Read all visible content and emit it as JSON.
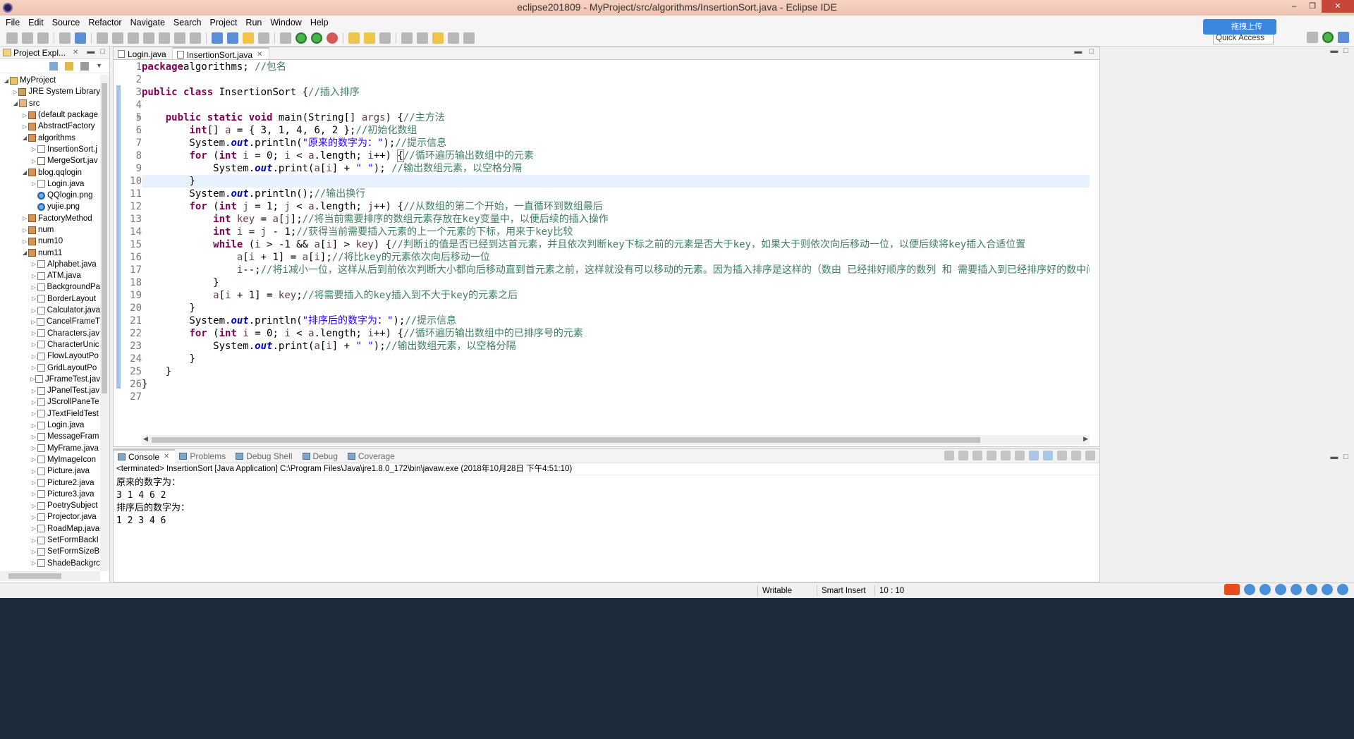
{
  "window": {
    "title": "eclipse201809 - MyProject/src/algorithms/InsertionSort.java - Eclipse IDE"
  },
  "menu": [
    "File",
    "Edit",
    "Source",
    "Refactor",
    "Navigate",
    "Search",
    "Project",
    "Run",
    "Window",
    "Help"
  ],
  "toolbar": {
    "quick_access": "Quick Access",
    "upload_label": "拖拽上传"
  },
  "project_explorer": {
    "title": "Project Expl...",
    "items": [
      {
        "label": "MyProject",
        "depth": 0,
        "icon": "project",
        "arrow": "▼"
      },
      {
        "label": "JRE System Library",
        "depth": 1,
        "icon": "lib",
        "arrow": "▶"
      },
      {
        "label": "src",
        "depth": 1,
        "icon": "src",
        "arrow": "▼"
      },
      {
        "label": "(default package",
        "depth": 2,
        "icon": "pkg",
        "arrow": "▶"
      },
      {
        "label": "AbstractFactory",
        "depth": 2,
        "icon": "pkg",
        "arrow": "▶"
      },
      {
        "label": "algorithms",
        "depth": 2,
        "icon": "pkg",
        "arrow": "▼"
      },
      {
        "label": "InsertionSort.j",
        "depth": 3,
        "icon": "java",
        "arrow": "▶"
      },
      {
        "label": "MergeSort.jav",
        "depth": 3,
        "icon": "javaerr",
        "arrow": "▶"
      },
      {
        "label": "blog.qqlogin",
        "depth": 2,
        "icon": "pkg",
        "arrow": "▼"
      },
      {
        "label": "Login.java",
        "depth": 3,
        "icon": "java",
        "arrow": "▶"
      },
      {
        "label": "QQlogin.png",
        "depth": 3,
        "icon": "png",
        "arrow": ""
      },
      {
        "label": "yujie.png",
        "depth": 3,
        "icon": "png",
        "arrow": ""
      },
      {
        "label": "FactoryMethod",
        "depth": 2,
        "icon": "pkg",
        "arrow": "▶"
      },
      {
        "label": "num",
        "depth": 2,
        "icon": "pkg",
        "arrow": "▶"
      },
      {
        "label": "num10",
        "depth": 2,
        "icon": "pkg",
        "arrow": "▶"
      },
      {
        "label": "num11",
        "depth": 2,
        "icon": "pkg",
        "arrow": "▼"
      },
      {
        "label": "Alphabet.java",
        "depth": 3,
        "icon": "java",
        "arrow": "▶"
      },
      {
        "label": "ATM.java",
        "depth": 3,
        "icon": "java",
        "arrow": "▶"
      },
      {
        "label": "BackgroundPa",
        "depth": 3,
        "icon": "java",
        "arrow": "▶"
      },
      {
        "label": "BorderLayout",
        "depth": 3,
        "icon": "java",
        "arrow": "▶"
      },
      {
        "label": "Calculator.java",
        "depth": 3,
        "icon": "java",
        "arrow": "▶"
      },
      {
        "label": "CancelFrameT",
        "depth": 3,
        "icon": "java",
        "arrow": "▶"
      },
      {
        "label": "Characters.jav",
        "depth": 3,
        "icon": "java",
        "arrow": "▶"
      },
      {
        "label": "CharacterUnic",
        "depth": 3,
        "icon": "java",
        "arrow": "▶"
      },
      {
        "label": "FlowLayoutPo",
        "depth": 3,
        "icon": "java",
        "arrow": "▶"
      },
      {
        "label": "GridLayoutPo",
        "depth": 3,
        "icon": "java",
        "arrow": "▶"
      },
      {
        "label": "JFrameTest.jav",
        "depth": 3,
        "icon": "java",
        "arrow": "▶"
      },
      {
        "label": "JPanelTest.jav",
        "depth": 3,
        "icon": "java",
        "arrow": "▶"
      },
      {
        "label": "JScrollPaneTe",
        "depth": 3,
        "icon": "java",
        "arrow": "▶"
      },
      {
        "label": "JTextFieldTest",
        "depth": 3,
        "icon": "java",
        "arrow": "▶"
      },
      {
        "label": "Login.java",
        "depth": 3,
        "icon": "java",
        "arrow": "▶"
      },
      {
        "label": "MessageFram",
        "depth": 3,
        "icon": "java",
        "arrow": "▶"
      },
      {
        "label": "MyFrame.java",
        "depth": 3,
        "icon": "java",
        "arrow": "▶"
      },
      {
        "label": "MyImageIcon",
        "depth": 3,
        "icon": "java",
        "arrow": "▶"
      },
      {
        "label": "Picture.java",
        "depth": 3,
        "icon": "java",
        "arrow": "▶"
      },
      {
        "label": "Picture2.java",
        "depth": 3,
        "icon": "java",
        "arrow": "▶"
      },
      {
        "label": "Picture3.java",
        "depth": 3,
        "icon": "java",
        "arrow": "▶"
      },
      {
        "label": "PoetrySubject",
        "depth": 3,
        "icon": "java",
        "arrow": "▶"
      },
      {
        "label": "Projector.java",
        "depth": 3,
        "icon": "java",
        "arrow": "▶"
      },
      {
        "label": "RoadMap.java",
        "depth": 3,
        "icon": "java",
        "arrow": "▶"
      },
      {
        "label": "SetFormBackI",
        "depth": 3,
        "icon": "java",
        "arrow": "▶"
      },
      {
        "label": "SetFormSizeB",
        "depth": 3,
        "icon": "java",
        "arrow": "▶"
      },
      {
        "label": "ShadeBackgrc",
        "depth": 3,
        "icon": "java",
        "arrow": "▶"
      }
    ]
  },
  "editor": {
    "tabs": [
      {
        "label": "Login.java",
        "active": false
      },
      {
        "label": "InsertionSort.java",
        "active": true
      }
    ],
    "current_line": 10,
    "lines": [
      [
        [
          "kw",
          "package"
        ],
        [
          "",
          "algorithms; "
        ],
        [
          "cm",
          "//包名"
        ]
      ],
      [],
      [
        [
          "kw",
          "public class"
        ],
        [
          "",
          " InsertionSort {"
        ],
        [
          "cm",
          "//插入排序"
        ]
      ],
      [],
      [
        [
          "",
          "    "
        ],
        [
          "kw",
          "public static void"
        ],
        [
          "",
          " main(String[] "
        ],
        [
          "vr",
          "args"
        ],
        [
          "",
          ") {"
        ],
        [
          "cm",
          "//主方法"
        ]
      ],
      [
        [
          "",
          "        "
        ],
        [
          "kw",
          "int"
        ],
        [
          "",
          "[] "
        ],
        [
          "vr",
          "a"
        ],
        [
          "",
          " = { 3, 1, 4, 6, 2 };"
        ],
        [
          "cm",
          "//初始化数组"
        ]
      ],
      [
        [
          "",
          "        System."
        ],
        [
          "fld",
          "out"
        ],
        [
          "",
          ".println("
        ],
        [
          "st",
          "\"原来的数字为：\""
        ],
        [
          "",
          ");"
        ],
        [
          "cm",
          "//提示信息"
        ]
      ],
      [
        [
          "",
          "        "
        ],
        [
          "kw",
          "for"
        ],
        [
          "",
          " ("
        ],
        [
          "kw",
          "int"
        ],
        [
          "",
          " "
        ],
        [
          "vr",
          "i"
        ],
        [
          "",
          " = 0; "
        ],
        [
          "vr",
          "i"
        ],
        [
          "",
          " < "
        ],
        [
          "vr",
          "a"
        ],
        [
          "",
          ".length; "
        ],
        [
          "vr",
          "i"
        ],
        [
          "",
          "++) "
        ],
        [
          "box",
          "{"
        ],
        [
          "cm",
          "//循环遍历输出数组中的元素"
        ]
      ],
      [
        [
          "",
          "            System."
        ],
        [
          "fld",
          "out"
        ],
        [
          "",
          ".print("
        ],
        [
          "vr",
          "a"
        ],
        [
          "",
          "["
        ],
        [
          "vr",
          "i"
        ],
        [
          "",
          "] + "
        ],
        [
          "st",
          "\" \""
        ],
        [
          "",
          "); "
        ],
        [
          "cm",
          "//输出数组元素，以空格分隔"
        ]
      ],
      [
        [
          "",
          "        }"
        ]
      ],
      [
        [
          "",
          "        System."
        ],
        [
          "fld",
          "out"
        ],
        [
          "",
          ".println();"
        ],
        [
          "cm",
          "//输出换行"
        ]
      ],
      [
        [
          "",
          "        "
        ],
        [
          "kw",
          "for"
        ],
        [
          "",
          " ("
        ],
        [
          "kw",
          "int"
        ],
        [
          "",
          " "
        ],
        [
          "vr",
          "j"
        ],
        [
          "",
          " = 1; "
        ],
        [
          "vr",
          "j"
        ],
        [
          "",
          " < "
        ],
        [
          "vr",
          "a"
        ],
        [
          "",
          ".length; "
        ],
        [
          "vr",
          "j"
        ],
        [
          "",
          "++) {"
        ],
        [
          "cm",
          "//从数组的第二个开始，一直循环到数组最后"
        ]
      ],
      [
        [
          "",
          "            "
        ],
        [
          "kw",
          "int"
        ],
        [
          "",
          " "
        ],
        [
          "vr",
          "key"
        ],
        [
          "",
          " = "
        ],
        [
          "vr",
          "a"
        ],
        [
          "",
          "["
        ],
        [
          "vr",
          "j"
        ],
        [
          "",
          "];"
        ],
        [
          "cm",
          "//将当前需要排序的数组元素存放在key变量中，以便后续的插入操作"
        ]
      ],
      [
        [
          "",
          "            "
        ],
        [
          "kw",
          "int"
        ],
        [
          "",
          " "
        ],
        [
          "vr",
          "i"
        ],
        [
          "",
          " = "
        ],
        [
          "vr",
          "j"
        ],
        [
          "",
          " - 1;"
        ],
        [
          "cm",
          "//获得当前需要插入元素的上一个元素的下标，用来于key比较"
        ]
      ],
      [
        [
          "",
          "            "
        ],
        [
          "kw",
          "while"
        ],
        [
          "",
          " ("
        ],
        [
          "vr",
          "i"
        ],
        [
          "",
          " > -1 && "
        ],
        [
          "vr",
          "a"
        ],
        [
          "",
          "["
        ],
        [
          "vr",
          "i"
        ],
        [
          "",
          "] > "
        ],
        [
          "vr",
          "key"
        ],
        [
          "",
          ") {"
        ],
        [
          "cm",
          "//判断i的值是否已经到达首元素，并且依次判断key下标之前的元素是否大于key，如果大于则依次向后移动一位，以便后续将key插入合适位置"
        ]
      ],
      [
        [
          "",
          "                "
        ],
        [
          "vr",
          "a"
        ],
        [
          "",
          "["
        ],
        [
          "vr",
          "i"
        ],
        [
          "",
          " + 1] = "
        ],
        [
          "vr",
          "a"
        ],
        [
          "",
          "["
        ],
        [
          "vr",
          "i"
        ],
        [
          "",
          "];"
        ],
        [
          "cm",
          "//将比key的元素依次向后移动一位"
        ]
      ],
      [
        [
          "",
          "                "
        ],
        [
          "vr",
          "i"
        ],
        [
          "",
          "--;"
        ],
        [
          "cm",
          "//将i减小一位，这样从后到前依次判断大小都向后移动直到首元素之前，这样就没有可以移动的元素。因为插入排序是这样的（数由 已经排好顺序的数列 和 需要插入到已经排序好的数中间的数 和 等待与已经排序好"
        ]
      ],
      [
        [
          "",
          "            }"
        ]
      ],
      [
        [
          "",
          "            "
        ],
        [
          "vr",
          "a"
        ],
        [
          "",
          "["
        ],
        [
          "vr",
          "i"
        ],
        [
          "",
          " + 1] = "
        ],
        [
          "vr",
          "key"
        ],
        [
          "",
          ";"
        ],
        [
          "cm",
          "//将需要插入的key插入到不大于key的元素之后"
        ]
      ],
      [
        [
          "",
          "        }"
        ]
      ],
      [
        [
          "",
          "        System."
        ],
        [
          "fld",
          "out"
        ],
        [
          "",
          ".println("
        ],
        [
          "st",
          "\"排序后的数字为：\""
        ],
        [
          "",
          ");"
        ],
        [
          "cm",
          "//提示信息"
        ]
      ],
      [
        [
          "",
          "        "
        ],
        [
          "kw",
          "for"
        ],
        [
          "",
          " ("
        ],
        [
          "kw",
          "int"
        ],
        [
          "",
          " "
        ],
        [
          "vr",
          "i"
        ],
        [
          "",
          " = 0; "
        ],
        [
          "vr",
          "i"
        ],
        [
          "",
          " < "
        ],
        [
          "vr",
          "a"
        ],
        [
          "",
          ".length; "
        ],
        [
          "vr",
          "i"
        ],
        [
          "",
          "++) {"
        ],
        [
          "cm",
          "//循环遍历输出数组中的已排序号的元素"
        ]
      ],
      [
        [
          "",
          "            System."
        ],
        [
          "fld",
          "out"
        ],
        [
          "",
          ".print("
        ],
        [
          "vr",
          "a"
        ],
        [
          "",
          "["
        ],
        [
          "vr",
          "i"
        ],
        [
          "",
          "] + "
        ],
        [
          "st",
          "\" \""
        ],
        [
          "",
          ");"
        ],
        [
          "cm",
          "//输出数组元素，以空格分隔"
        ]
      ],
      [
        [
          "",
          "        }"
        ]
      ],
      [
        [
          "",
          "    }"
        ]
      ],
      [
        [
          "",
          "}"
        ]
      ],
      []
    ]
  },
  "console": {
    "tabs": [
      {
        "label": "Console",
        "active": true,
        "closable": true
      },
      {
        "label": "Problems",
        "active": false
      },
      {
        "label": "Debug Shell",
        "active": false
      },
      {
        "label": "Debug",
        "active": false
      },
      {
        "label": "Coverage",
        "active": false
      }
    ],
    "header": "<terminated> InsertionSort [Java Application] C:\\Program Files\\Java\\jre1.8.0_172\\bin\\javaw.exe (2018年10月28日 下午4:51:10)",
    "output": [
      "原来的数字为：",
      "3 1 4 6 2",
      "排序后的数字为：",
      "1 2 3 4 6"
    ]
  },
  "status": {
    "writable": "Writable",
    "insert_mode": "Smart Insert",
    "position": "10 : 10"
  }
}
